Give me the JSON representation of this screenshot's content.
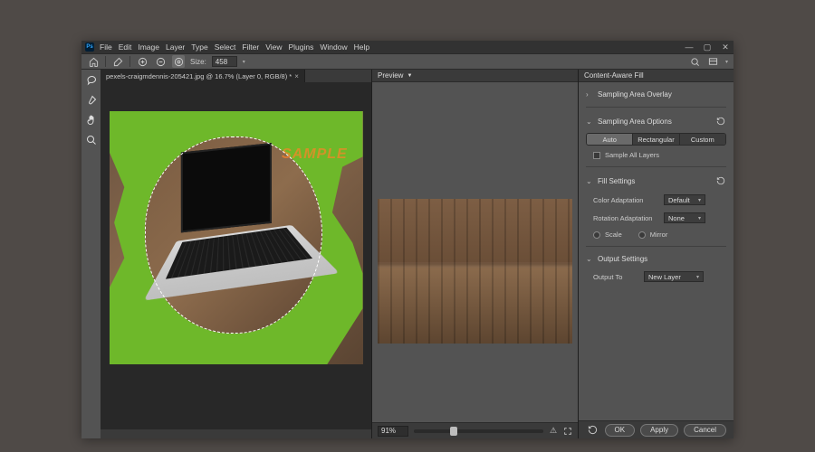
{
  "menubar": [
    "File",
    "Edit",
    "Image",
    "Layer",
    "Type",
    "Select",
    "Filter",
    "View",
    "Plugins",
    "Window",
    "Help"
  ],
  "optionsbar": {
    "size_label": "Size:",
    "size_value": "458"
  },
  "document": {
    "tab_title": "pexels-craigmdennis-205421.jpg @ 16.7% (Layer 0, RGB/8) *",
    "watermark": "SAMPLE"
  },
  "preview": {
    "title": "Preview",
    "zoom": "91%"
  },
  "caf": {
    "title": "Content-Aware Fill",
    "sampling_overlay": "Sampling Area Overlay",
    "sampling_options": "Sampling Area Options",
    "mode": {
      "auto": "Auto",
      "rect": "Rectangular",
      "custom": "Custom"
    },
    "sample_all": "Sample All Layers",
    "fill_settings": "Fill Settings",
    "color_adapt_label": "Color Adaptation",
    "color_adapt_value": "Default",
    "rotation_label": "Rotation Adaptation",
    "rotation_value": "None",
    "scale": "Scale",
    "mirror": "Mirror",
    "output_settings": "Output Settings",
    "output_to_label": "Output To",
    "output_to_value": "New Layer"
  },
  "buttons": {
    "ok": "OK",
    "apply": "Apply",
    "cancel": "Cancel"
  }
}
